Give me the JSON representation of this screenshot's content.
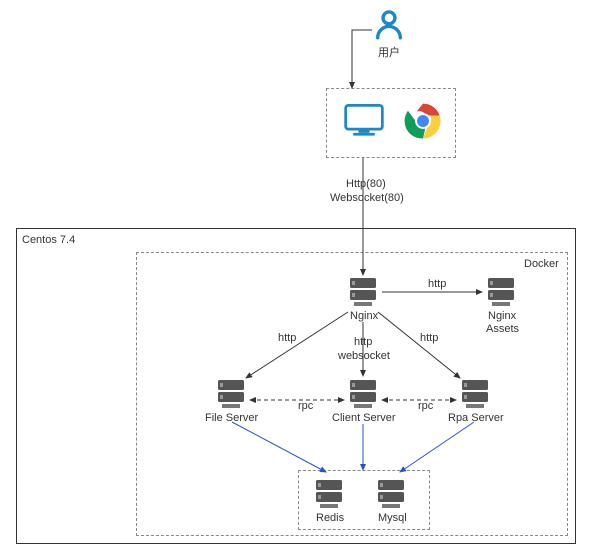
{
  "user": {
    "label": "用户"
  },
  "transport": {
    "http_label": "Http(80)",
    "ws_label": "Websocket(80)"
  },
  "os_box": {
    "label": "Centos 7.4"
  },
  "docker_box": {
    "label": "Docker"
  },
  "nodes": {
    "nginx": "Nginx",
    "nginx_assets_l1": "Nginx",
    "nginx_assets_l2": "Assets",
    "file_server": "File Server",
    "client_server": "Client Server",
    "rpa_server": "Rpa Server",
    "redis": "Redis",
    "mysql": "Mysql"
  },
  "edges": {
    "http_to_assets": "http",
    "http_to_file": "http",
    "http_ws_to_client_l1": "http",
    "http_ws_to_client_l2": "websocket",
    "http_to_rpa": "http",
    "rpc_left": "rpc",
    "rpc_right": "rpc"
  },
  "chart_data": {
    "type": "diagram",
    "title": "",
    "nodes": [
      {
        "id": "user",
        "label": "用户",
        "type": "actor"
      },
      {
        "id": "desktop",
        "label": "Desktop Client",
        "type": "client"
      },
      {
        "id": "browser",
        "label": "Chrome Browser",
        "type": "client"
      },
      {
        "id": "nginx",
        "label": "Nginx",
        "type": "server"
      },
      {
        "id": "nginx_assets",
        "label": "Nginx Assets",
        "type": "server"
      },
      {
        "id": "file_server",
        "label": "File Server",
        "type": "server"
      },
      {
        "id": "client_server",
        "label": "Client Server",
        "type": "server"
      },
      {
        "id": "rpa_server",
        "label": "Rpa Server",
        "type": "server"
      },
      {
        "id": "redis",
        "label": "Redis",
        "type": "datastore"
      },
      {
        "id": "mysql",
        "label": "Mysql",
        "type": "datastore"
      }
    ],
    "groups": [
      {
        "id": "client_group",
        "contains": [
          "desktop",
          "browser"
        ],
        "style": "dashed"
      },
      {
        "id": "centos",
        "label": "Centos 7.4",
        "contains": [
          "docker"
        ],
        "style": "solid"
      },
      {
        "id": "docker",
        "label": "Docker",
        "contains": [
          "nginx",
          "nginx_assets",
          "file_server",
          "client_server",
          "rpa_server",
          "db_group"
        ],
        "style": "dashed"
      },
      {
        "id": "db_group",
        "contains": [
          "redis",
          "mysql"
        ],
        "style": "dashed"
      }
    ],
    "edges": [
      {
        "from": "user",
        "to": "client_group",
        "label": "",
        "style": "solid"
      },
      {
        "from": "client_group",
        "to": "nginx",
        "label": "Http(80) / Websocket(80)",
        "style": "solid"
      },
      {
        "from": "nginx",
        "to": "nginx_assets",
        "label": "http",
        "style": "solid"
      },
      {
        "from": "nginx",
        "to": "file_server",
        "label": "http",
        "style": "solid"
      },
      {
        "from": "nginx",
        "to": "client_server",
        "label": "http websocket",
        "style": "solid"
      },
      {
        "from": "nginx",
        "to": "rpa_server",
        "label": "http",
        "style": "solid"
      },
      {
        "from": "file_server",
        "to": "client_server",
        "label": "rpc",
        "style": "dashed",
        "bidirectional": true
      },
      {
        "from": "rpa_server",
        "to": "client_server",
        "label": "rpc",
        "style": "dashed",
        "bidirectional": true
      },
      {
        "from": "file_server",
        "to": "db_group",
        "label": "",
        "style": "solid",
        "color": "blue"
      },
      {
        "from": "client_server",
        "to": "db_group",
        "label": "",
        "style": "solid",
        "color": "blue"
      },
      {
        "from": "rpa_server",
        "to": "db_group",
        "label": "",
        "style": "solid",
        "color": "blue"
      }
    ]
  }
}
